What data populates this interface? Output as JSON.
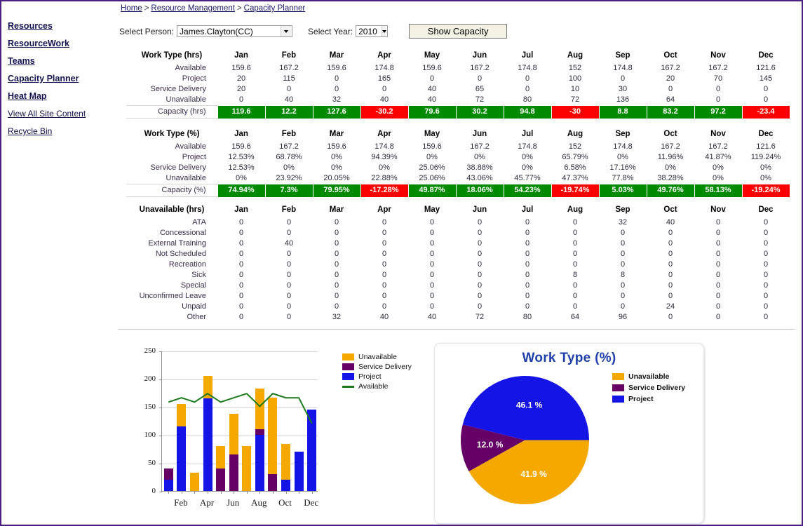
{
  "breadcrumb": {
    "items": [
      "Home",
      "Resource Management",
      "Capacity Planner"
    ],
    "separator": ">"
  },
  "sidebar": {
    "items": [
      {
        "label": "Resources",
        "style": "bold"
      },
      {
        "label": "ResourceWork",
        "style": "bold"
      },
      {
        "label": "Teams",
        "style": "bold"
      },
      {
        "label": "Capacity Planner",
        "style": "bold"
      },
      {
        "label": "Heat Map",
        "style": "bold"
      },
      {
        "label": "View All Site Content",
        "style": "plain"
      },
      {
        "label": "Recycle Bin",
        "style": "plain"
      }
    ]
  },
  "toolbar": {
    "person_label": "Select Person:",
    "person_value": "James.Clayton(CC)",
    "year_label": "Select Year:",
    "year_value": "2010",
    "show_capacity_label": "Show Capacity"
  },
  "months": [
    "Jan",
    "Feb",
    "Mar",
    "Apr",
    "May",
    "Jun",
    "Jul",
    "Aug",
    "Sep",
    "Oct",
    "Nov",
    "Dec"
  ],
  "table_hrs": {
    "title": "Work Type (hrs)",
    "rows": [
      {
        "label": "Available",
        "values": [
          "159.6",
          "167.2",
          "159.6",
          "174.8",
          "159.6",
          "167.2",
          "174.8",
          "152",
          "174.8",
          "167.2",
          "167.2",
          "121.6"
        ]
      },
      {
        "label": "Project",
        "values": [
          "20",
          "115",
          "0",
          "165",
          "0",
          "0",
          "0",
          "100",
          "0",
          "20",
          "70",
          "145"
        ]
      },
      {
        "label": "Service Delivery",
        "values": [
          "20",
          "0",
          "0",
          "0",
          "40",
          "65",
          "0",
          "10",
          "30",
          "0",
          "0",
          "0"
        ]
      },
      {
        "label": "Unavailable",
        "values": [
          "0",
          "40",
          "32",
          "40",
          "40",
          "72",
          "80",
          "72",
          "136",
          "64",
          "0",
          "0"
        ]
      }
    ],
    "capacity": {
      "label": "Capacity (hrs)",
      "values": [
        "119.6",
        "12.2",
        "127.6",
        "-30.2",
        "79.6",
        "30.2",
        "94.8",
        "-30",
        "8.8",
        "83.2",
        "97.2",
        "-23.4"
      ]
    }
  },
  "table_pct": {
    "title": "Work Type (%)",
    "rows": [
      {
        "label": "Available",
        "values": [
          "159.6",
          "167.2",
          "159.6",
          "174.8",
          "159.6",
          "167.2",
          "174.8",
          "152",
          "174.8",
          "167.2",
          "167.2",
          "121.6"
        ]
      },
      {
        "label": "Project",
        "values": [
          "12.53%",
          "68.78%",
          "0%",
          "94.39%",
          "0%",
          "0%",
          "0%",
          "65.79%",
          "0%",
          "11.96%",
          "41.87%",
          "119.24%"
        ]
      },
      {
        "label": "Service Delivery",
        "values": [
          "12.53%",
          "0%",
          "0%",
          "0%",
          "25.06%",
          "38.88%",
          "0%",
          "6.58%",
          "17.16%",
          "0%",
          "0%",
          "0%"
        ]
      },
      {
        "label": "Unavailable",
        "values": [
          "0%",
          "23.92%",
          "20.05%",
          "22.88%",
          "25.06%",
          "43.06%",
          "45.77%",
          "47.37%",
          "77.8%",
          "38.28%",
          "0%",
          "0%"
        ]
      }
    ],
    "capacity": {
      "label": "Capacity (%)",
      "values": [
        "74.94%",
        "7.3%",
        "79.95%",
        "-17.28%",
        "49.87%",
        "18.06%",
        "54.23%",
        "-19.74%",
        "5.03%",
        "49.76%",
        "58.13%",
        "-19.24%"
      ]
    }
  },
  "table_unavailable": {
    "title": "Unavailable (hrs)",
    "rows": [
      {
        "label": "ATA",
        "values": [
          "0",
          "0",
          "0",
          "0",
          "0",
          "0",
          "0",
          "0",
          "32",
          "40",
          "0",
          "0"
        ]
      },
      {
        "label": "Concessional",
        "values": [
          "0",
          "0",
          "0",
          "0",
          "0",
          "0",
          "0",
          "0",
          "0",
          "0",
          "0",
          "0"
        ]
      },
      {
        "label": "External Training",
        "values": [
          "0",
          "40",
          "0",
          "0",
          "0",
          "0",
          "0",
          "0",
          "0",
          "0",
          "0",
          "0"
        ]
      },
      {
        "label": "Not Scheduled",
        "values": [
          "0",
          "0",
          "0",
          "0",
          "0",
          "0",
          "0",
          "0",
          "0",
          "0",
          "0",
          "0"
        ]
      },
      {
        "label": "Recreation",
        "values": [
          "0",
          "0",
          "0",
          "0",
          "0",
          "0",
          "0",
          "0",
          "0",
          "0",
          "0",
          "0"
        ]
      },
      {
        "label": "Sick",
        "values": [
          "0",
          "0",
          "0",
          "0",
          "0",
          "0",
          "0",
          "8",
          "8",
          "0",
          "0",
          "0"
        ]
      },
      {
        "label": "Special",
        "values": [
          "0",
          "0",
          "0",
          "0",
          "0",
          "0",
          "0",
          "0",
          "0",
          "0",
          "0",
          "0"
        ]
      },
      {
        "label": "Unconfirmed Leave",
        "values": [
          "0",
          "0",
          "0",
          "0",
          "0",
          "0",
          "0",
          "0",
          "0",
          "0",
          "0",
          "0"
        ]
      },
      {
        "label": "Unpaid",
        "values": [
          "0",
          "0",
          "0",
          "0",
          "0",
          "0",
          "0",
          "0",
          "0",
          "24",
          "0",
          "0"
        ]
      },
      {
        "label": "Other",
        "values": [
          "0",
          "0",
          "32",
          "40",
          "40",
          "72",
          "80",
          "64",
          "96",
          "0",
          "0",
          "0"
        ]
      }
    ]
  },
  "colors": {
    "unavailable": "#f5a800",
    "service_delivery": "#660066",
    "project": "#1414e6",
    "available": "#1a7a1a",
    "capacity_positive": "#008a00",
    "capacity_negative": "#fa0000",
    "page_border": "#4b2080",
    "pie_title": "#1f3faa"
  },
  "chart_data": [
    {
      "type": "bar",
      "stacked": true,
      "title": "",
      "xlabel": "",
      "ylabel": "",
      "ylim": [
        0,
        250
      ],
      "yticks": [
        0,
        50,
        100,
        150,
        200,
        250
      ],
      "categories": [
        "Jan",
        "Feb",
        "Mar",
        "Apr",
        "May",
        "Jun",
        "Jul",
        "Aug",
        "Sep",
        "Oct",
        "Nov",
        "Dec"
      ],
      "visible_xticklabels": [
        "Feb",
        "Apr",
        "Jun",
        "Aug",
        "Oct",
        "Dec"
      ],
      "grid": true,
      "legend_position": "right",
      "series": [
        {
          "name": "Project",
          "color": "#1414e6",
          "kind": "bar",
          "values": [
            20,
            115,
            0,
            165,
            0,
            0,
            0,
            100,
            0,
            20,
            70,
            145
          ]
        },
        {
          "name": "Service Delivery",
          "color": "#660066",
          "kind": "bar",
          "values": [
            20,
            0,
            0,
            0,
            40,
            65,
            0,
            10,
            30,
            0,
            0,
            0
          ]
        },
        {
          "name": "Unavailable",
          "color": "#f5a800",
          "kind": "bar",
          "values": [
            0,
            40,
            32,
            40,
            40,
            72,
            80,
            72,
            136,
            64,
            0,
            0
          ]
        },
        {
          "name": "Available",
          "color": "#1a7a1a",
          "kind": "line",
          "values": [
            159.6,
            167.2,
            159.6,
            174.8,
            159.6,
            167.2,
            174.8,
            152,
            174.8,
            167.2,
            167.2,
            121.6
          ]
        }
      ],
      "legend_order": [
        "Unavailable",
        "Service Delivery",
        "Project",
        "Available"
      ]
    },
    {
      "type": "pie",
      "title": "Work Type (%)",
      "legend_position": "right",
      "labels": [
        "Unavailable",
        "Service Delivery",
        "Project"
      ],
      "values": [
        41.9,
        12.0,
        46.1
      ],
      "value_labels": [
        "41.9 %",
        "12.0 %",
        "46.1 %"
      ],
      "colors": [
        "#f5a800",
        "#660066",
        "#1414e6"
      ]
    }
  ]
}
